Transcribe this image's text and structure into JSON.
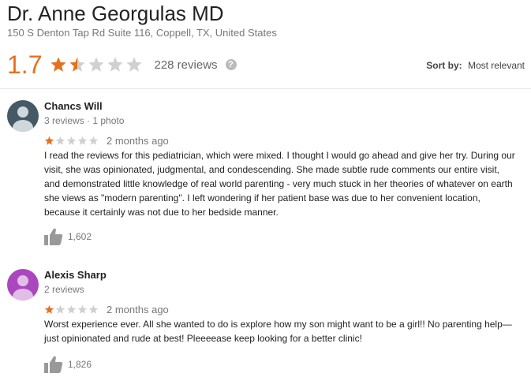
{
  "place": {
    "name": "Dr. Anne Georgulas MD",
    "address": "150 S Denton Tap Rd Suite 116, Coppell, TX, United States"
  },
  "summary": {
    "rating": "1.7",
    "rating_value": 1.7,
    "max_stars": 5,
    "reviews_count": "228 reviews",
    "help_icon": "help-icon",
    "star_color": "#e7711b",
    "empty_star_color": "#d0d0d0"
  },
  "sort": {
    "label": "Sort by:",
    "value": "Most relevant"
  },
  "reviews": [
    {
      "name": "Chancs Will",
      "meta": "3 reviews · 1 photo",
      "stars": 1,
      "date": "2 months ago",
      "text": "I read the reviews for this pediatrician, which were mixed.  I thought I would go ahead and give her try.  During our visit, she was opinionated, judgmental, and condescending.   She made subtle rude comments our entire visit, and demonstrated little knowledge of real world parenting - very much stuck in her theories of whatever on earth she views as \"modern parenting\".  I left wondering if her patient base was due to her convenient location, because it certainly was not due to her bedside manner.",
      "likes": "1,602",
      "avatar_color": "#455a64",
      "avatar_icon": "person-icon"
    },
    {
      "name": "Alexis Sharp",
      "meta": "2 reviews",
      "stars": 1,
      "date": "2 months ago",
      "text": "Worst experience ever. All she wanted to do is explore how my son might want to be a girl!! No parenting help—just opinionated and rude at best! Pleeeease keep looking for a better clinic!",
      "likes": "1,826",
      "avatar_color": "#ab47bc",
      "avatar_icon": "person-icon"
    }
  ]
}
